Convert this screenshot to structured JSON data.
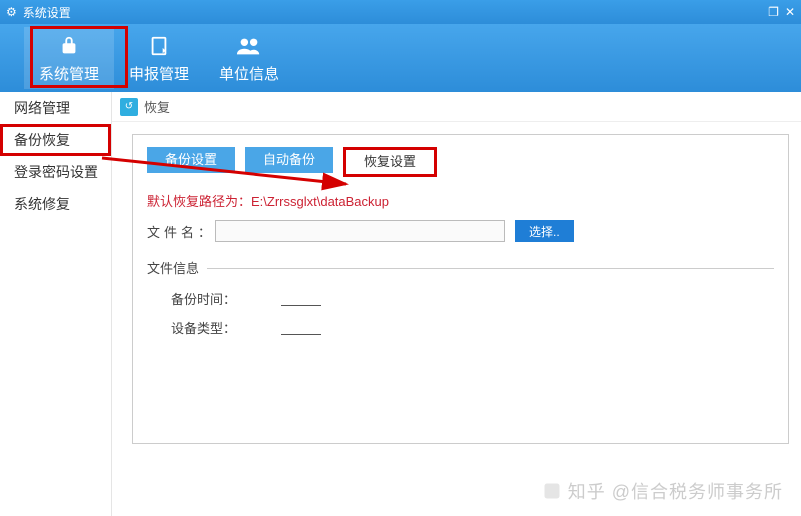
{
  "title": "系统设置",
  "toolbar": [
    {
      "label": "系统管理",
      "icon": "lock"
    },
    {
      "label": "申报管理",
      "icon": "form"
    },
    {
      "label": "单位信息",
      "icon": "users"
    }
  ],
  "sidebar": {
    "items": [
      {
        "label": "网络管理"
      },
      {
        "label": "备份恢复"
      },
      {
        "label": "登录密码设置"
      },
      {
        "label": "系统修复"
      }
    ]
  },
  "breadcrumb": {
    "label": "恢复"
  },
  "tabs": [
    {
      "label": "备份设置"
    },
    {
      "label": "自动备份"
    },
    {
      "label": "恢复设置"
    }
  ],
  "content": {
    "default_path": "默认恢复路径为：E:\\Zrrssglxt\\dataBackup",
    "file_label": "文件名：",
    "file_value": "",
    "select_label": "选择..",
    "fileinfo_label": "文件信息",
    "backup_time_label": "备份时间：",
    "device_type_label": "设备类型："
  },
  "watermark": "知乎 @信合税务师事务所"
}
